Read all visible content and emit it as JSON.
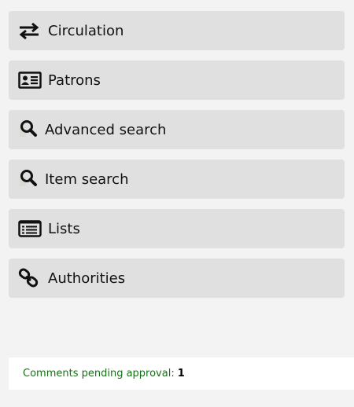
{
  "menu": {
    "items": [
      {
        "label": "Circulation",
        "icon": "transfer-arrows-icon"
      },
      {
        "label": "Patrons",
        "icon": "id-card-icon"
      },
      {
        "label": "Advanced search",
        "icon": "search-icon"
      },
      {
        "label": "Item search",
        "icon": "search-icon"
      },
      {
        "label": "Lists",
        "icon": "list-icon"
      },
      {
        "label": "Authorities",
        "icon": "link-icon"
      }
    ]
  },
  "pending": {
    "label": "Comments pending approval:",
    "count": "1"
  },
  "colors": {
    "background": "#f3f3f3",
    "menu_item_bg": "#e0e0e0",
    "pending_text": "#1a6e1a"
  }
}
